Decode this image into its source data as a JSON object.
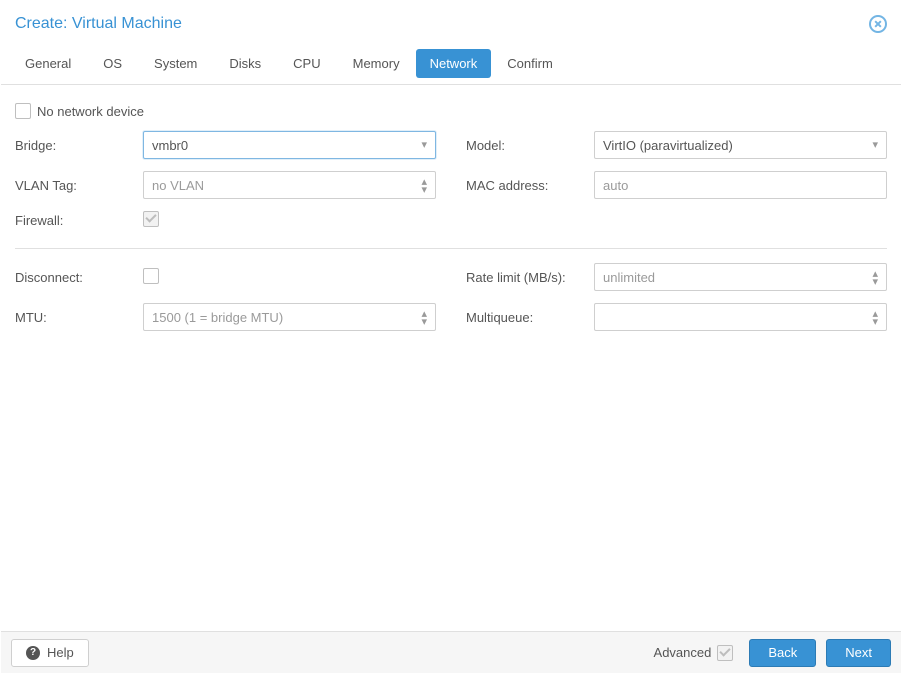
{
  "title": "Create: Virtual Machine",
  "tabs": [
    "General",
    "OS",
    "System",
    "Disks",
    "CPU",
    "Memory",
    "Network",
    "Confirm"
  ],
  "active_tab_index": 6,
  "no_network_label": "No network device",
  "no_network_checked": false,
  "left": {
    "bridge": {
      "label": "Bridge:",
      "value": "vmbr0"
    },
    "vlan": {
      "label": "VLAN Tag:",
      "value": "no VLAN"
    },
    "firewall": {
      "label": "Firewall:",
      "checked": true
    },
    "disconnect": {
      "label": "Disconnect:",
      "checked": false
    },
    "mtu": {
      "label": "MTU:",
      "value": "1500 (1 = bridge MTU)"
    }
  },
  "right": {
    "model": {
      "label": "Model:",
      "value": "VirtIO (paravirtualized)"
    },
    "mac": {
      "label": "MAC address:",
      "value": "auto"
    },
    "rate": {
      "label": "Rate limit (MB/s):",
      "value": "unlimited"
    },
    "multiqueue": {
      "label": "Multiqueue:",
      "value": ""
    }
  },
  "footer": {
    "help": "Help",
    "advanced": "Advanced",
    "advanced_checked": true,
    "back": "Back",
    "next": "Next"
  }
}
